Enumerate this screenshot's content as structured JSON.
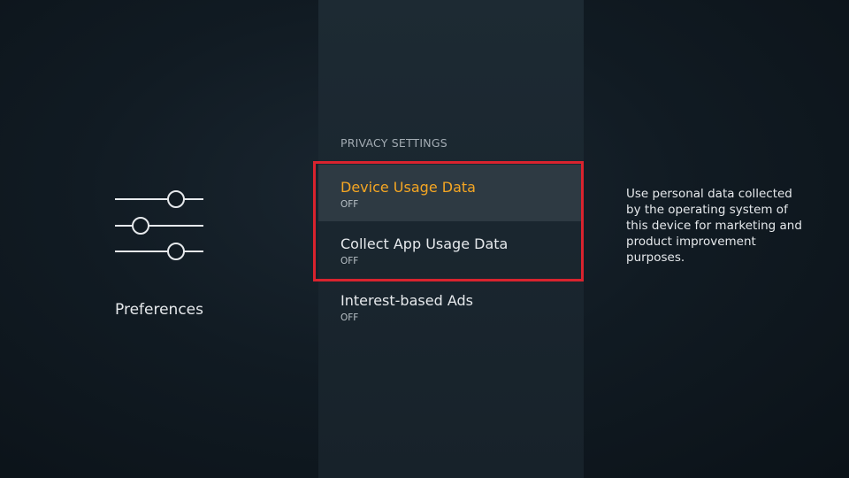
{
  "left": {
    "icon": "sliders-icon",
    "label": "Preferences"
  },
  "middle": {
    "section_header": "PRIVACY SETTINGS",
    "items": [
      {
        "title": "Device Usage Data",
        "value": "OFF",
        "focused": true
      },
      {
        "title": "Collect App Usage Data",
        "value": "OFF",
        "focused": false
      },
      {
        "title": "Interest-based Ads",
        "value": "OFF",
        "focused": false
      }
    ]
  },
  "right": {
    "description": "Use personal data collected by the operating system of this device for marketing and product improvement purposes."
  },
  "colors": {
    "focus_text": "#f5a623",
    "highlight_border": "#d9232e",
    "focused_row_bg": "#2e3a43"
  }
}
